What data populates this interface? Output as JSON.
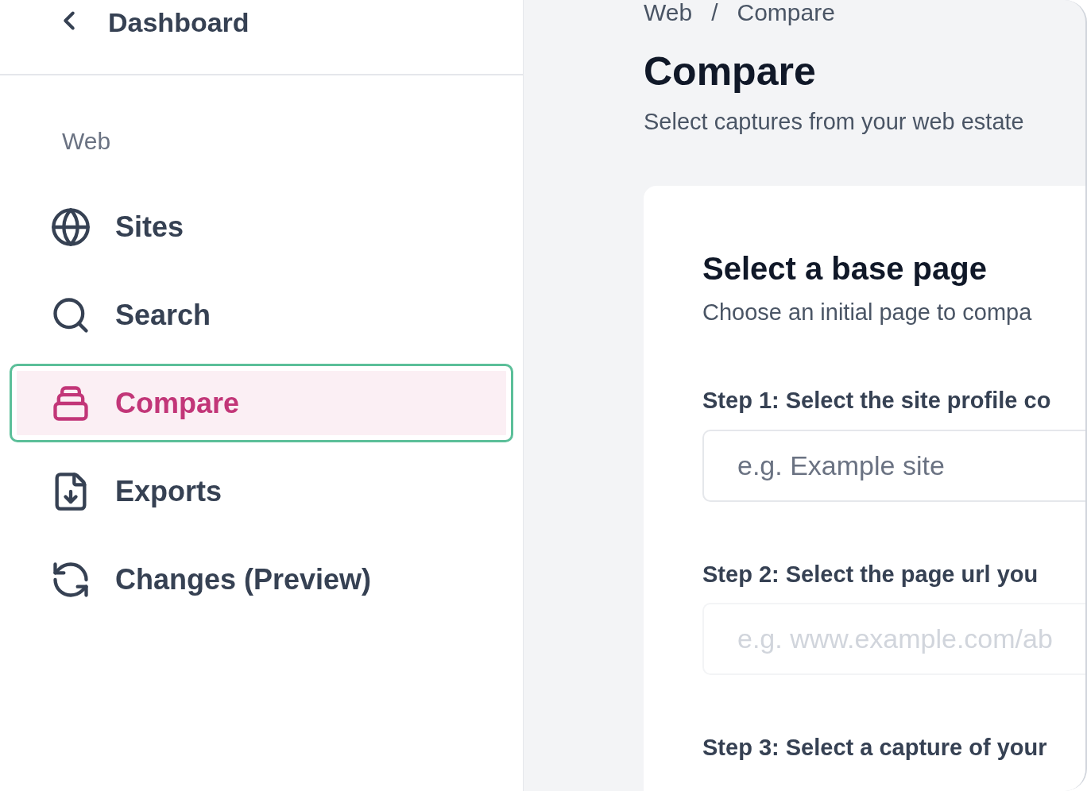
{
  "sidebar": {
    "back": {
      "label": "Dashboard"
    },
    "section": "Web",
    "items": [
      {
        "label": "Sites",
        "kind": "globe",
        "selected": false
      },
      {
        "label": "Search",
        "kind": "search",
        "selected": false
      },
      {
        "label": "Compare",
        "kind": "stack",
        "selected": true
      },
      {
        "label": "Exports",
        "kind": "file",
        "selected": false
      },
      {
        "label": "Changes (Preview)",
        "kind": "refresh",
        "selected": false
      }
    ]
  },
  "breadcrumb": [
    "Web",
    "Compare"
  ],
  "breadcrumb_separator": "/",
  "title": "Compare",
  "subtitle": "Select captures from your web estate",
  "card": {
    "title": "Select a base page",
    "description": "Choose an initial page to compa",
    "steps": [
      {
        "label": "Step 1: Select the site profile co",
        "placeholder": "e.g. Example site",
        "disabled": false
      },
      {
        "label": "Step 2: Select the page url you",
        "placeholder": "e.g. www.example.com/ab",
        "disabled": true
      },
      {
        "label": "Step 3: Select a capture of your"
      }
    ]
  }
}
